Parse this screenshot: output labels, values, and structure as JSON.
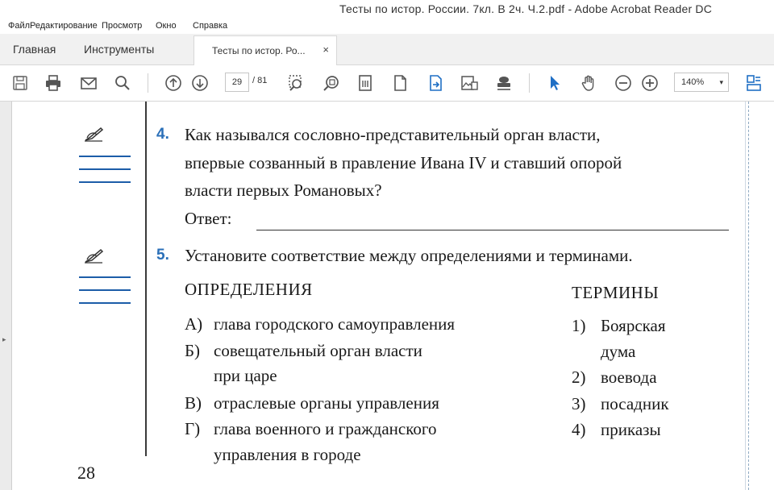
{
  "window": {
    "title": "Тесты по истор. России. 7кл. В 2ч. Ч.2.pdf - Adobe Acrobat Reader DC"
  },
  "menu": [
    "Файл",
    "Редактирование",
    "Просмотр",
    "Окно",
    "Справка"
  ],
  "tabs": {
    "home": "Главная",
    "tools": "Инструменты",
    "document": "Тесты по истор. Ро...",
    "close": "×"
  },
  "toolbar": {
    "page_current": "29",
    "page_total": "/ 81",
    "zoom": "140%",
    "zoom_arrow": "▾",
    "icons": [
      "save-icon",
      "print-icon",
      "email-icon",
      "search-icon",
      "page-up-icon",
      "page-down-icon",
      "marquee-zoom-icon",
      "zoom-tool-icon",
      "fit-page-icon",
      "document-icon",
      "export-icon",
      "image-icon",
      "stamp-icon",
      "select-cursor-icon",
      "hand-icon",
      "zoom-out-icon",
      "zoom-in-icon",
      "reading-mode-icon"
    ],
    "accent": "#1f6fc5"
  },
  "document": {
    "q4": {
      "num": "4.",
      "lines": [
        "Как назывался сословно-представительный орган власти,",
        "впервые созванный в правление Ивана IV и ставший опорой",
        "власти первых Романовых?"
      ],
      "answer_label": "Ответ:"
    },
    "q5": {
      "num": "5.",
      "text": "Установите соответствие между определениями и терминами.",
      "definitions_header": "ОПРЕДЕЛЕНИЯ",
      "terms_header": "ТЕРМИНЫ",
      "definitions": [
        {
          "label": "А)",
          "lines": [
            "глава городского самоуправления"
          ]
        },
        {
          "label": "Б)",
          "lines": [
            "совещательный орган власти",
            "при царе"
          ]
        },
        {
          "label": "В)",
          "lines": [
            "отраслевые органы управления"
          ]
        },
        {
          "label": "Г)",
          "lines": [
            "глава военного и гражданского",
            "управления в городе"
          ]
        }
      ],
      "terms": [
        {
          "label": "1)",
          "lines": [
            "Боярская",
            "дума"
          ]
        },
        {
          "label": "2)",
          "lines": [
            "воевода"
          ]
        },
        {
          "label": "3)",
          "lines": [
            "посадник"
          ]
        },
        {
          "label": "4)",
          "lines": [
            "приказы"
          ]
        }
      ]
    },
    "page_number": "28"
  }
}
